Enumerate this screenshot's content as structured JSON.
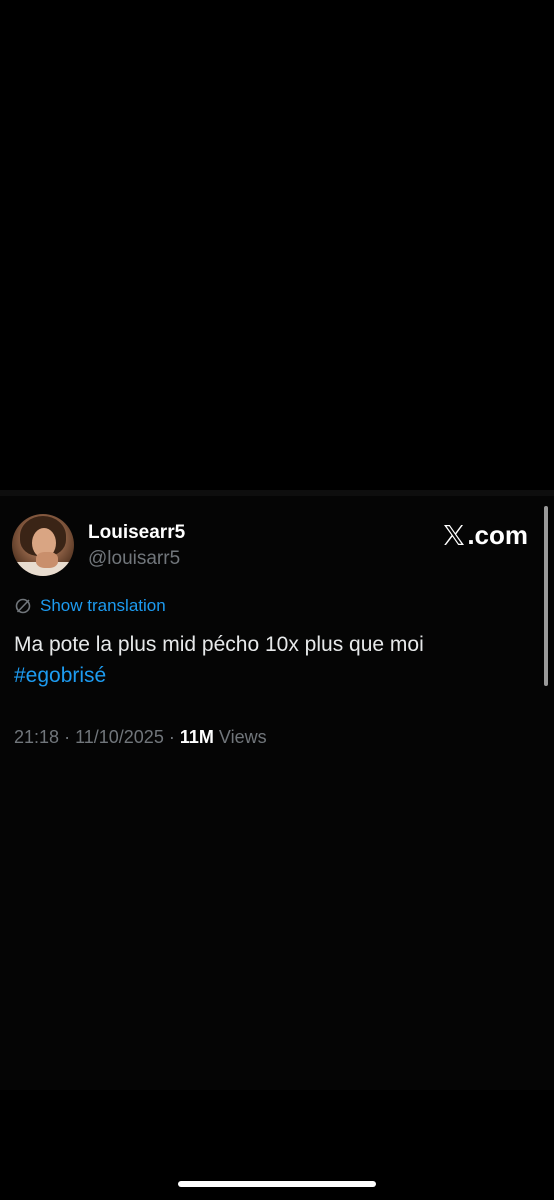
{
  "tweet": {
    "display_name": "Louisearr5",
    "handle": "@louisarr5",
    "brand": ".com",
    "translate_label": "Show translation",
    "text_line1": "Ma pote la plus mid pécho 10x plus que moi",
    "hashtag": "#egobrisé",
    "time": "21:18",
    "date": "11/10/2025",
    "views_count": "11M",
    "views_label": "Views",
    "separator": "·"
  },
  "icons": {
    "brand_logo": "x-logo-icon",
    "translate": "translate-icon",
    "avatar": "profile-photo"
  },
  "colors": {
    "background": "#000000",
    "link": "#1d9bf0",
    "muted": "#71767b",
    "text": "#e7e9ea"
  }
}
